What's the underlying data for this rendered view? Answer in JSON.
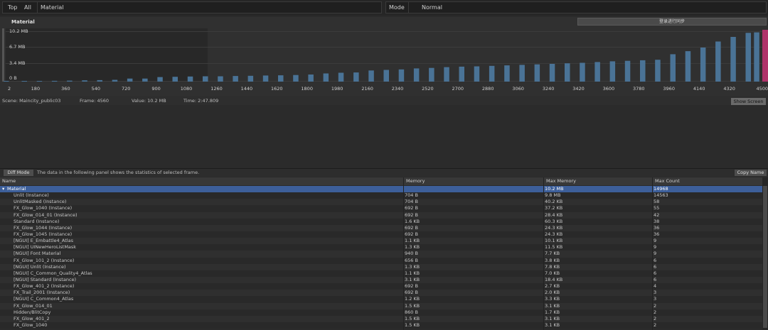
{
  "topbar": {
    "top_label": "Top",
    "all_label": "All",
    "material_value": "Material",
    "mode_label": "Mode",
    "mode_value": "Normal"
  },
  "chart_panel": {
    "title": "Material",
    "sync_button_label": "登录进行同步"
  },
  "chart_data": {
    "type": "bar",
    "title": "Material",
    "xlabel": "",
    "ylabel": "",
    "ylim": [
      0,
      10.2
    ],
    "y_unit": "MB",
    "y_tick_labels": [
      "10.2 MB",
      "6.7 MB",
      "3.4 MB",
      "0 B"
    ],
    "y_ticks": [
      10.2,
      6.7,
      3.4,
      0
    ],
    "x_tick_labels": [
      "2",
      "180",
      "360",
      "540",
      "720",
      "900",
      "1080",
      "1260",
      "1440",
      "1620",
      "1800",
      "1980",
      "2160",
      "2340",
      "2520",
      "2700",
      "2880",
      "3060",
      "3240",
      "3420",
      "3600",
      "3780",
      "3960",
      "4140",
      "4320",
      "4500"
    ],
    "x_ticks": [
      2,
      180,
      360,
      540,
      720,
      900,
      1080,
      1260,
      1440,
      1620,
      1800,
      1980,
      2160,
      2340,
      2520,
      2700,
      2880,
      3060,
      3240,
      3420,
      3600,
      3780,
      3960,
      4140,
      4320,
      4500
    ],
    "bar_color": "#4a7396",
    "selected_bar_color": "#b0336a",
    "bars": [
      {
        "x": 2,
        "value": 0.05
      },
      {
        "x": 110,
        "value": 0.1
      },
      {
        "x": 200,
        "value": 0.1
      },
      {
        "x": 290,
        "value": 0.15
      },
      {
        "x": 380,
        "value": 0.2
      },
      {
        "x": 470,
        "value": 0.25
      },
      {
        "x": 560,
        "value": 0.3
      },
      {
        "x": 650,
        "value": 0.35
      },
      {
        "x": 740,
        "value": 0.6
      },
      {
        "x": 830,
        "value": 0.6
      },
      {
        "x": 920,
        "value": 0.9
      },
      {
        "x": 1010,
        "value": 0.95
      },
      {
        "x": 1100,
        "value": 1.0
      },
      {
        "x": 1190,
        "value": 1.05
      },
      {
        "x": 1280,
        "value": 1.05
      },
      {
        "x": 1370,
        "value": 1.1
      },
      {
        "x": 1460,
        "value": 1.15
      },
      {
        "x": 1550,
        "value": 1.2
      },
      {
        "x": 1640,
        "value": 1.25
      },
      {
        "x": 1730,
        "value": 1.3
      },
      {
        "x": 1820,
        "value": 1.4
      },
      {
        "x": 1910,
        "value": 1.6
      },
      {
        "x": 2000,
        "value": 1.75
      },
      {
        "x": 2090,
        "value": 1.8
      },
      {
        "x": 2180,
        "value": 2.2
      },
      {
        "x": 2270,
        "value": 2.3
      },
      {
        "x": 2360,
        "value": 2.4
      },
      {
        "x": 2450,
        "value": 2.6
      },
      {
        "x": 2540,
        "value": 2.7
      },
      {
        "x": 2630,
        "value": 2.85
      },
      {
        "x": 2720,
        "value": 2.95
      },
      {
        "x": 2810,
        "value": 3.0
      },
      {
        "x": 2900,
        "value": 3.1
      },
      {
        "x": 2990,
        "value": 3.2
      },
      {
        "x": 3080,
        "value": 3.3
      },
      {
        "x": 3170,
        "value": 3.4
      },
      {
        "x": 3260,
        "value": 3.5
      },
      {
        "x": 3350,
        "value": 3.6
      },
      {
        "x": 3440,
        "value": 3.7
      },
      {
        "x": 3530,
        "value": 3.85
      },
      {
        "x": 3620,
        "value": 4.0
      },
      {
        "x": 3710,
        "value": 4.1
      },
      {
        "x": 3800,
        "value": 4.2
      },
      {
        "x": 3890,
        "value": 4.3
      },
      {
        "x": 3980,
        "value": 5.4
      },
      {
        "x": 4070,
        "value": 6.0
      },
      {
        "x": 4160,
        "value": 6.7
      },
      {
        "x": 4250,
        "value": 7.9
      },
      {
        "x": 4340,
        "value": 8.8
      },
      {
        "x": 4430,
        "value": 9.6
      },
      {
        "x": 4480,
        "value": 9.7
      }
    ],
    "selected_value": 10.2,
    "selected_frame": 4560
  },
  "info": {
    "scene": "Scene: Maincity_public03",
    "frame": "Frame: 4560",
    "value": "Value: 10.2 MB",
    "time": "Time: 2:47.809",
    "show_screen_label": "Show Screen"
  },
  "diff": {
    "button_label": "Diff Mode",
    "description": "The data in the following panel shows the statistics of selected frame.",
    "copy_button_label": "Copy Name"
  },
  "table": {
    "headers": [
      "Name",
      "Memory",
      "Max Memory",
      "Max Count"
    ],
    "rows": [
      {
        "name": "Material",
        "memory": "",
        "max_memory": "10.2 MB",
        "max_count": "14968",
        "selected": true
      },
      {
        "name": "Unlit (Instance)",
        "memory": "704 B",
        "max_memory": "9.8 MB",
        "max_count": "14563"
      },
      {
        "name": "UnlitMasked (Instance)",
        "memory": "704 B",
        "max_memory": "40.2 KB",
        "max_count": "58"
      },
      {
        "name": "FX_Glow_1040 (Instance)",
        "memory": "692 B",
        "max_memory": "37.2 KB",
        "max_count": "55"
      },
      {
        "name": "FX_Glow_014_01 (Instance)",
        "memory": "692 B",
        "max_memory": "28.4 KB",
        "max_count": "42"
      },
      {
        "name": "Standard (Instance)",
        "memory": "1.6 KB",
        "max_memory": "60.3 KB",
        "max_count": "38"
      },
      {
        "name": "FX_Glow_1044 (Instance)",
        "memory": "692 B",
        "max_memory": "24.3 KB",
        "max_count": "36"
      },
      {
        "name": "FX_Glow_1045 (Instance)",
        "memory": "692 B",
        "max_memory": "24.3 KB",
        "max_count": "36"
      },
      {
        "name": "[NGUI] E_Embattle4_Atlas",
        "memory": "1.1 KB",
        "max_memory": "10.1 KB",
        "max_count": "9"
      },
      {
        "name": "[NGUI] UINewHeroListMask",
        "memory": "1.3 KB",
        "max_memory": "11.5 KB",
        "max_count": "9"
      },
      {
        "name": "[NGUI] Font Material",
        "memory": "940 B",
        "max_memory": "7.7 KB",
        "max_count": "9"
      },
      {
        "name": "FX_Glow_101_2 (Instance)",
        "memory": "656 B",
        "max_memory": "3.8 KB",
        "max_count": "6"
      },
      {
        "name": "[NGUI] Unlit (Instance)",
        "memory": "1.3 KB",
        "max_memory": "7.8 KB",
        "max_count": "6"
      },
      {
        "name": "[NGUI] C_Common_Quality4_Atlas",
        "memory": "1.1 KB",
        "max_memory": "7.0 KB",
        "max_count": "6"
      },
      {
        "name": "[NGUI] Standard (Instance)",
        "memory": "3.1 KB",
        "max_memory": "18.4 KB",
        "max_count": "6"
      },
      {
        "name": "FX_Glow_401_2 (Instance)",
        "memory": "692 B",
        "max_memory": "2.7 KB",
        "max_count": "4"
      },
      {
        "name": "FX_Trail_2001 (Instance)",
        "memory": "692 B",
        "max_memory": "2.0 KB",
        "max_count": "3"
      },
      {
        "name": "[NGUI] C_Common4_Atlas",
        "memory": "1.2 KB",
        "max_memory": "3.3 KB",
        "max_count": "3"
      },
      {
        "name": "FX_Glow_014_01",
        "memory": "1.5 KB",
        "max_memory": "3.1 KB",
        "max_count": "2"
      },
      {
        "name": "Hidden/BlitCopy",
        "memory": "860 B",
        "max_memory": "1.7 KB",
        "max_count": "2"
      },
      {
        "name": "FX_Glow_401_2",
        "memory": "1.5 KB",
        "max_memory": "3.1 KB",
        "max_count": "2"
      },
      {
        "name": "FX_Glow_1040",
        "memory": "1.5 KB",
        "max_memory": "3.1 KB",
        "max_count": "2"
      }
    ]
  }
}
